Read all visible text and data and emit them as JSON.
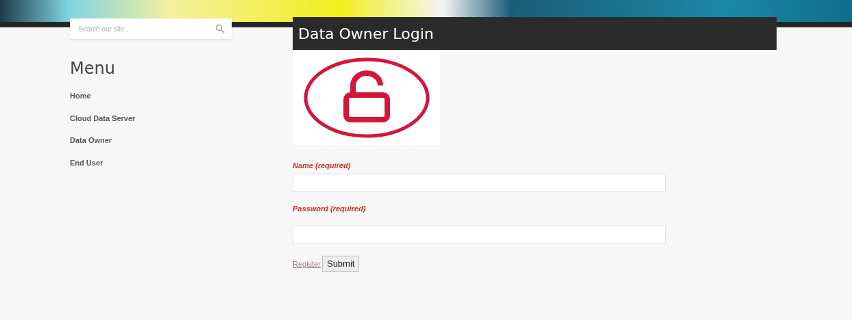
{
  "search": {
    "placeholder": "Search our site.."
  },
  "menu": {
    "title": "Menu",
    "items": [
      {
        "label": "Home"
      },
      {
        "label": "Cloud Data Server"
      },
      {
        "label": "Data Owner"
      },
      {
        "label": "End User"
      }
    ]
  },
  "main": {
    "title": "Data Owner Login",
    "fields": [
      {
        "label": "Name (required)"
      },
      {
        "label": "Password (required)"
      }
    ],
    "register_link": "Register",
    "submit_button": "Submit"
  }
}
